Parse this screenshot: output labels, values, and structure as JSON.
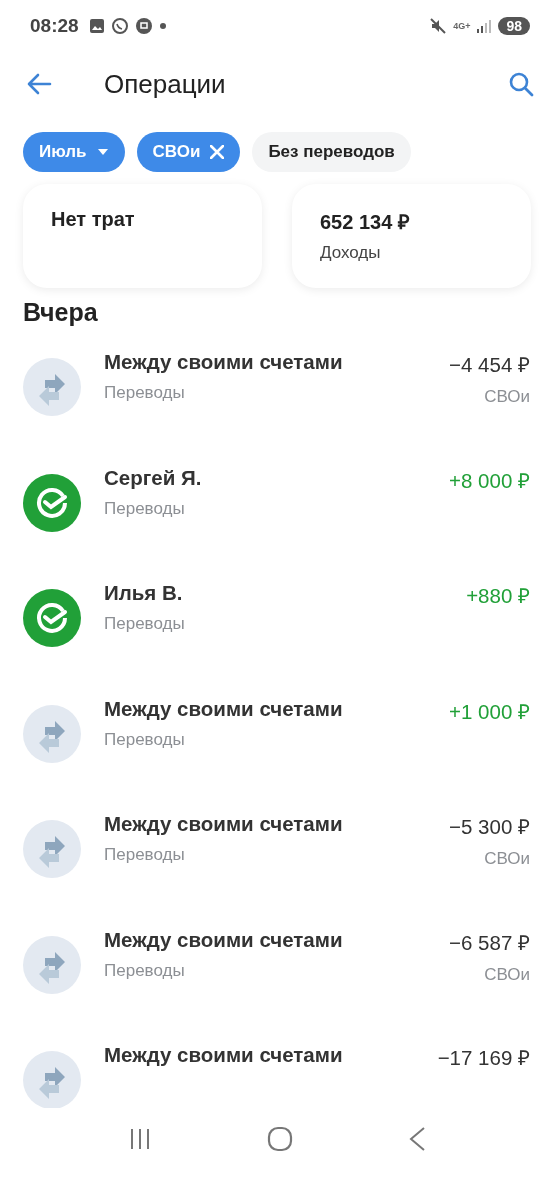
{
  "status_bar": {
    "time": "08:28",
    "battery": "98",
    "network": "4G+"
  },
  "header": {
    "title": "Операции"
  },
  "filters": [
    {
      "label": "Июль",
      "kind": "dropdown",
      "selected": true
    },
    {
      "label": "СВОи",
      "kind": "removable",
      "selected": true
    },
    {
      "label": "Без переводов",
      "kind": "plain",
      "selected": false
    }
  ],
  "summary": [
    {
      "value": "Нет трат"
    },
    {
      "value": "652 134 ₽",
      "caption": "Доходы"
    }
  ],
  "section": "Вчера",
  "operations": [
    {
      "kind": "transfer",
      "title": "Между своими счетами",
      "category": "Переводы",
      "amount": "−4 454 ₽",
      "income": false,
      "account": "СВОи"
    },
    {
      "kind": "person",
      "title": "Сергей Я.",
      "category": "Переводы",
      "amount": "+8 000 ₽",
      "income": true
    },
    {
      "kind": "person",
      "title": "Илья В.",
      "category": "Переводы",
      "amount": "+880 ₽",
      "income": true
    },
    {
      "kind": "transfer",
      "title": "Между своими счетами",
      "category": "Переводы",
      "amount": "+1 000 ₽",
      "income": true
    },
    {
      "kind": "transfer",
      "title": "Между своими счетами",
      "category": "Переводы",
      "amount": "−5 300 ₽",
      "income": false,
      "account": "СВОи"
    },
    {
      "kind": "transfer",
      "title": "Между своими счетами",
      "category": "Переводы",
      "amount": "−6 587 ₽",
      "income": false,
      "account": "СВОи"
    },
    {
      "kind": "transfer",
      "title": "Между своими счетами",
      "amount": "−17 169 ₽",
      "income": false
    }
  ]
}
